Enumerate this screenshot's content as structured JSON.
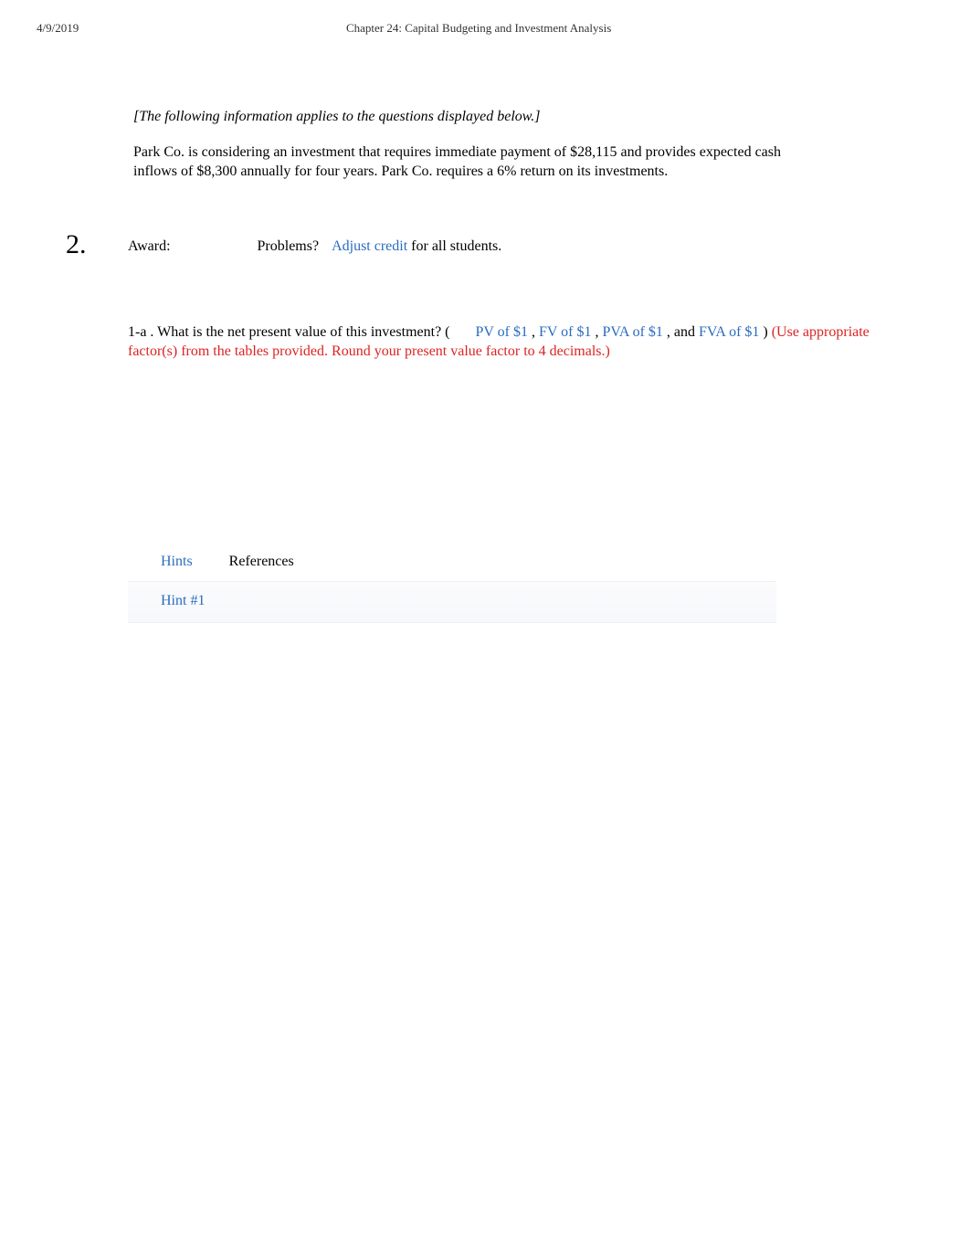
{
  "header": {
    "date": "4/9/2019",
    "title": "Chapter 24: Capital Budgeting and Investment Analysis"
  },
  "intro": {
    "note": "[The following information applies to the questions displayed below.]",
    "description": "Park Co. is considering an investment that requires immediate payment of $28,115 and provides expected cash inflows of $8,300 annually for four years. Park Co. requires a 6% return on its investments."
  },
  "question": {
    "number": "2.",
    "award_label": "Award:",
    "problems_label": "Problems?",
    "adjust_credit": "Adjust credit",
    "after_credit": " for all students.",
    "text_lead": "1-a . What is the net present value of this investment? (",
    "link_pv": "PV of $1",
    "sep1": " , ",
    "link_fv": "FV of $1",
    "sep2": " , ",
    "link_pva": "PVA of $1",
    "sep3": "  , and  ",
    "link_fva": "FVA of $1",
    "close_paren": " ) ",
    "red_note": "(Use appropriate factor(s) from the tables provided. Round your present value factor to 4 decimals.)"
  },
  "tabs": {
    "hints": "Hints",
    "references": "References",
    "hint1": "Hint #1"
  }
}
